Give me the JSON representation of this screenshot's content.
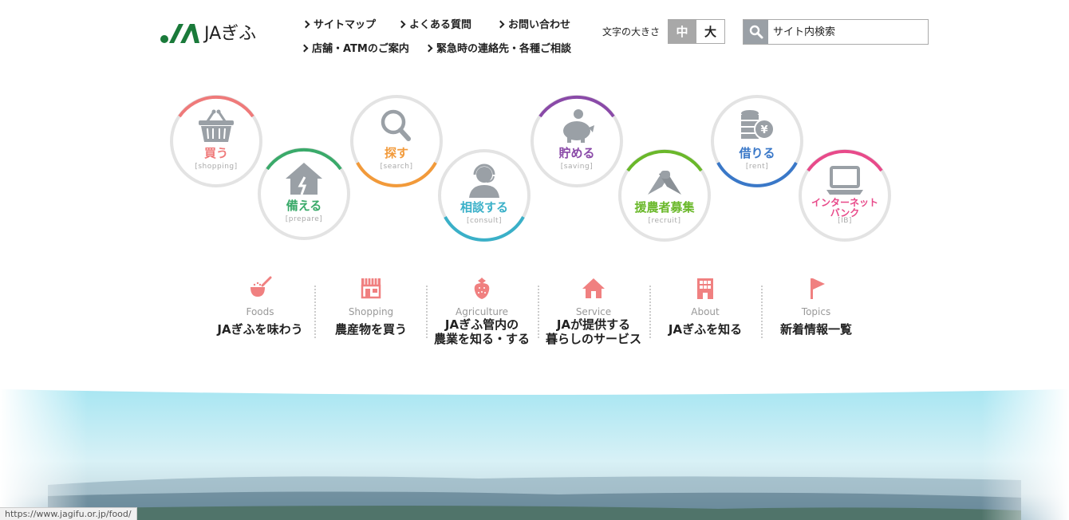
{
  "header": {
    "logo_text": "JAぎふ",
    "nav": [
      {
        "label": "サイトマップ"
      },
      {
        "label": "よくある質問"
      },
      {
        "label": "お問い合わせ"
      },
      {
        "label": "店舗・ATMのご案内"
      },
      {
        "label": "緊急時の連絡先・各種ご相談"
      }
    ],
    "fontsize": {
      "label": "文字の大きさ",
      "medium": "中",
      "large": "大"
    },
    "search": {
      "placeholder": "サイト内検索"
    }
  },
  "services": [
    {
      "label": "買う",
      "sub": "[shopping]",
      "color": "#ef7a7a",
      "icon": "basket-icon"
    },
    {
      "label": "備える",
      "sub": "[prepare]",
      "color": "#3aaa6a",
      "icon": "house-icon"
    },
    {
      "label": "探す",
      "sub": "[search]",
      "color": "#f29a3a",
      "icon": "magnifier-icon"
    },
    {
      "label": "相談する",
      "sub": "[consult]",
      "color": "#3ab0c8",
      "icon": "operator-icon"
    },
    {
      "label": "貯める",
      "sub": "[saving]",
      "color": "#8a4aa8",
      "icon": "piggy-bank-icon"
    },
    {
      "label": "援農者募集",
      "sub": "[recruit]",
      "color": "#6ab82a",
      "icon": "handshake-icon"
    },
    {
      "label": "借りる",
      "sub": "[rent]",
      "color": "#3a78c8",
      "icon": "coins-yen-icon"
    },
    {
      "label": "インターネットバンク",
      "label_line1": "インターネット",
      "label_line2": "バンク",
      "sub": "[IB]",
      "color": "#e84a8a",
      "icon": "laptop-icon"
    }
  ],
  "categories": [
    {
      "en": "Foods",
      "jp": "JAぎふを味わう",
      "icon": "ladle-icon"
    },
    {
      "en": "Shopping",
      "jp": "農産物を買う",
      "icon": "shop-icon"
    },
    {
      "en": "Agriculture",
      "jp1": "JAぎふ管内の",
      "jp2": "農業を知る・する",
      "icon": "strawberry-icon"
    },
    {
      "en": "Service",
      "jp1": "JAが提供する",
      "jp2": "暮らしのサービス",
      "icon": "home-icon"
    },
    {
      "en": "About",
      "jp": "JAぎふを知る",
      "icon": "building-icon"
    },
    {
      "en": "Topics",
      "jp": "新着情報一覧",
      "icon": "flag-icon"
    }
  ],
  "status_url": "https://www.jagifu.or.jp/food/",
  "colors": {
    "accent_pink": "#f08080",
    "ring_gray": "#e3e3e3",
    "logo_green": "#1a7a3a"
  }
}
